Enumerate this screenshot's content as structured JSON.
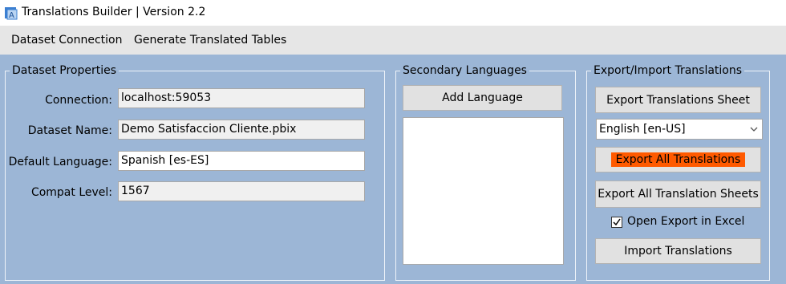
{
  "window": {
    "title": "Translations Builder | Version 2.2"
  },
  "menu": {
    "items": [
      "Dataset Connection",
      "Generate Translated Tables"
    ]
  },
  "dataset_properties": {
    "title": "Dataset Properties",
    "connection_label": "Connection:",
    "connection_value": "localhost:59053",
    "dataset_name_label": "Dataset Name:",
    "dataset_name_value": "Demo Satisfaccion Cliente.pbix",
    "default_language_label": "Default Language:",
    "default_language_value": "Spanish [es-ES]",
    "compat_level_label": "Compat Level:",
    "compat_level_value": "1567"
  },
  "secondary_languages": {
    "title": "Secondary Languages",
    "add_button": "Add Language",
    "items": []
  },
  "export_import": {
    "title": "Export/Import Translations",
    "export_sheet_button": "Export Translations Sheet",
    "language_selected": "English [en-US]",
    "export_all_button": "Export All Translations",
    "export_all_sheets_button": "Export All Translation Sheets",
    "open_in_excel_label": "Open Export in Excel",
    "open_in_excel_checked": true,
    "import_button": "Import Translations"
  },
  "colors": {
    "background": "#9cb6d6",
    "menubar": "#e6e6e6",
    "highlight": "#ff5a00"
  }
}
